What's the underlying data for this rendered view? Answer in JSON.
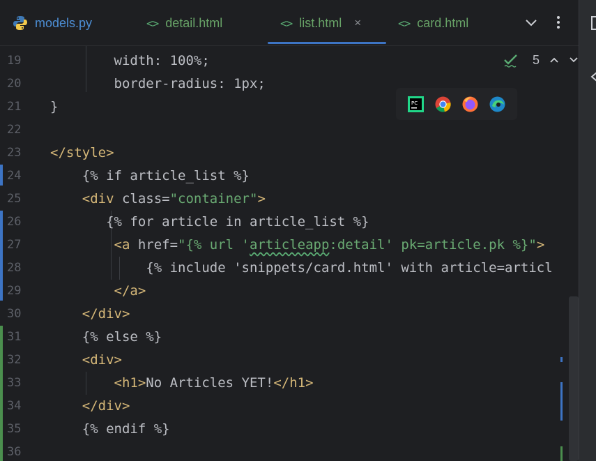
{
  "tabs": [
    {
      "label": "models.py",
      "icon": "python-icon"
    },
    {
      "label": "detail.html",
      "icon": "html-icon"
    },
    {
      "label": "list.html",
      "icon": "html-icon",
      "active": true,
      "closable": true
    },
    {
      "label": "card.html",
      "icon": "html-icon"
    }
  ],
  "tab_icon_glyph": "<>",
  "close_glyph": "×",
  "inspections": {
    "count": "5"
  },
  "browsers": [
    "pycharm-icon",
    "chrome-icon",
    "firefox-icon",
    "edge-icon"
  ],
  "pycharm_badge": "PC",
  "lines": [
    {
      "num": "19",
      "indent": "        ",
      "code": "width: 100%;"
    },
    {
      "num": "20",
      "indent": "        ",
      "code": "border-radius: 1px;"
    },
    {
      "num": "21",
      "indent": "",
      "code": "}"
    },
    {
      "num": "22",
      "indent": "",
      "code": ""
    },
    {
      "num": "23",
      "indent": "",
      "open": "</style>"
    },
    {
      "num": "24",
      "indent": "    ",
      "code": "{% if article_list %}"
    },
    {
      "num": "25",
      "indent": "    ",
      "open": "<div",
      "attr": " class=",
      "str": "\"container\"",
      "close": ">"
    },
    {
      "num": "26",
      "indent": "       ",
      "code": "{% for article in article_list %}"
    },
    {
      "num": "27",
      "indent": "        ",
      "open": "<a",
      "attr": " href=",
      "str_a": "\"{% url '",
      "squig": "articleapp",
      "str_b": ":detail' pk=article.pk %}\"",
      "close": ">"
    },
    {
      "num": "28",
      "indent": "            ",
      "code": "{% include 'snippets/card.html' with article=articl"
    },
    {
      "num": "29",
      "indent": "        ",
      "open": "</a>"
    },
    {
      "num": "30",
      "indent": "    ",
      "open": "</div>"
    },
    {
      "num": "31",
      "indent": "    ",
      "code": "{% else %}"
    },
    {
      "num": "32",
      "indent": "    ",
      "open": "<div>"
    },
    {
      "num": "33",
      "indent": "        ",
      "open": "<h1>",
      "code": "No Articles YET!",
      "close": "</h1>"
    },
    {
      "num": "34",
      "indent": "    ",
      "open": "</div>"
    },
    {
      "num": "35",
      "indent": "    ",
      "code": "{% endif %}"
    },
    {
      "num": "36",
      "indent": "",
      "code": ""
    }
  ],
  "colors": {
    "background": "#1e1f22",
    "tag": "#d5b778",
    "string": "#6aab73",
    "text": "#bcbec4",
    "line_number": "#5d6068",
    "modified_marker": "#3d74c4",
    "added_marker": "#4b8f4e"
  }
}
